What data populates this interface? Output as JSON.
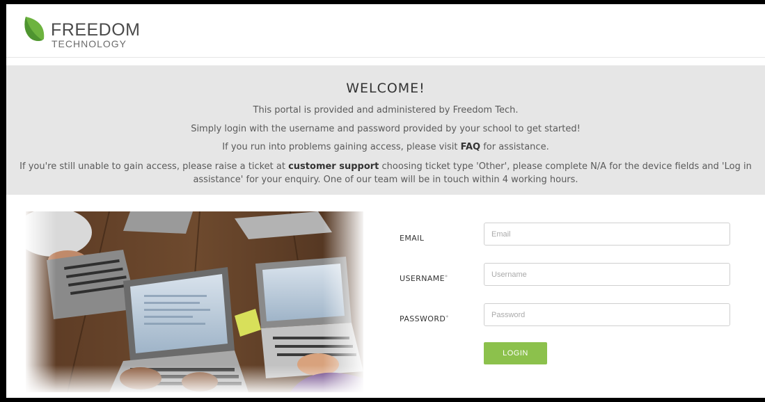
{
  "brand": {
    "name": "FREEDOM",
    "subtitle": "TECHNOLOGY",
    "leaf_color": "#6db33f",
    "leaf_dark": "#3f7f2a"
  },
  "welcome": {
    "heading": "WELCOME!",
    "line1": "This portal is provided and administered by Freedom Tech.",
    "line2": "Simply login with the username and password provided by your school to get started!",
    "line3_pre": "If you run into problems gaining access, please visit ",
    "line3_link": "FAQ",
    "line3_post": " for assistance.",
    "line4_pre": "If you're still unable to gain access, please raise a ticket at ",
    "line4_link": "customer support",
    "line4_post": " choosing ticket type 'Other', please complete N/A for the device fields and 'Log in assistance' for your enquiry. One of our team will be in touch within 4 working hours."
  },
  "form": {
    "email_label": "EMAIL",
    "email_placeholder": "Email",
    "username_label": "USERNAME",
    "username_placeholder": "Username",
    "password_label": "PASSWORD",
    "password_placeholder": "Password",
    "required_mark": "*",
    "login_label": "LOGIN",
    "login_color": "#8cc14c"
  },
  "photo": {
    "subject": "students-using-laptops-on-wooden-table"
  }
}
